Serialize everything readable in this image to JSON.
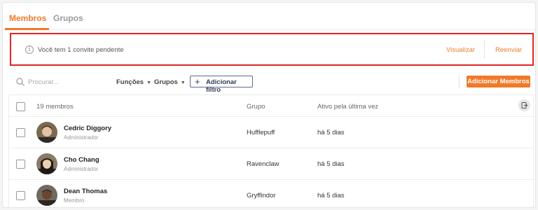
{
  "tabs": [
    {
      "label": "Membros",
      "active": true
    },
    {
      "label": "Grupos",
      "active": false
    }
  ],
  "banner": {
    "icon": "info-icon",
    "text": "Você tem 1 convite pendente",
    "view_label": "Visualizar",
    "resend_label": "Reenviar"
  },
  "toolbar": {
    "search_placeholder": "Procurar...",
    "functions_label": "Funções",
    "groups_label": "Grupos",
    "add_filter_label": "Adicionar filtro",
    "add_members_label": "Adicionar Membros"
  },
  "table": {
    "count_label": "19 membros",
    "group_header": "Grupo",
    "last_active_header": "Ativo pela última vez",
    "rows": [
      {
        "name": "Cedric Diggory",
        "role": "Administrador",
        "group": "Hufflepuff",
        "last_active": "há 5 dias"
      },
      {
        "name": "Cho Chang",
        "role": "Administrador",
        "group": "Ravenclaw",
        "last_active": "há 5 dias"
      },
      {
        "name": "Dean Thomas",
        "role": "Membro",
        "group": "Gryffindor",
        "last_active": "há 5 dias"
      }
    ]
  },
  "colors": {
    "accent": "#f07a2a",
    "banner_border": "#e02424"
  }
}
